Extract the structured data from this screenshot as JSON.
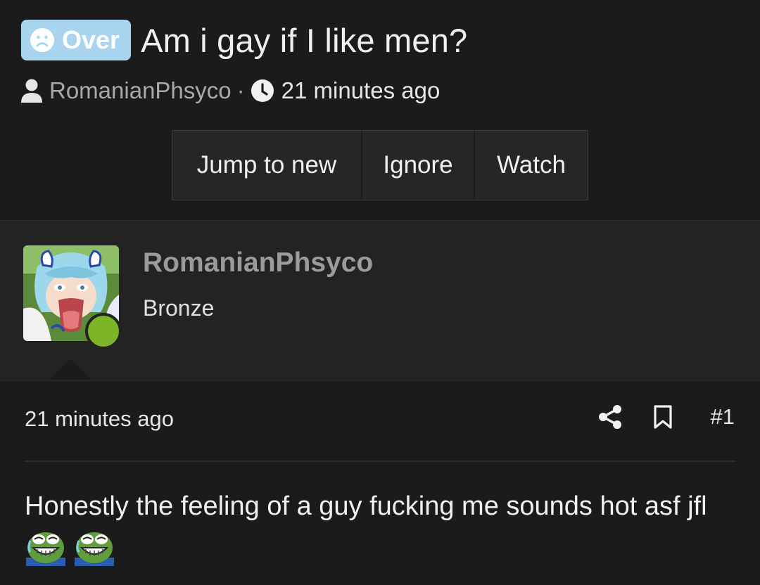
{
  "thread": {
    "prefix": "Over",
    "title": "Am i gay if I like men?",
    "author": "RomanianPhsyco",
    "separator": "·",
    "time": "21 minutes ago"
  },
  "buttons": {
    "jump": "Jump to new",
    "ignore": "Ignore",
    "watch": "Watch"
  },
  "post": {
    "username": "RomanianPhsyco",
    "user_title": "Bronze",
    "time": "21 minutes ago",
    "number": "#1",
    "body": "Honestly the feeling of a guy fucking me sounds hot asf jfl",
    "emoji_icon": "laughing-crying-pepe-icon"
  },
  "colors": {
    "prefix_bg": "#a8d4f0",
    "online": "#7cb627",
    "background": "#1b1b1b",
    "panel": "#232323"
  }
}
